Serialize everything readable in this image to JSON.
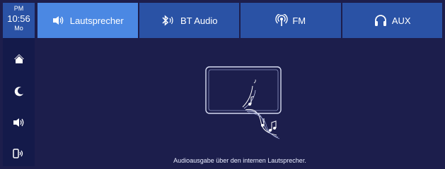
{
  "clock": {
    "ampm": "PM",
    "time": "10:56",
    "day": "Mo"
  },
  "sidebar": {
    "items": [
      {
        "icon": "home-icon"
      },
      {
        "icon": "moon-icon"
      },
      {
        "icon": "speaker-icon"
      },
      {
        "icon": "phone-audio-icon"
      }
    ]
  },
  "tabs": [
    {
      "label": "Lautsprecher",
      "icon": "speaker-icon",
      "active": true
    },
    {
      "label": "BT Audio",
      "icon": "bluetooth-icon",
      "active": false
    },
    {
      "label": "FM",
      "icon": "radio-icon",
      "active": false
    },
    {
      "label": "AUX",
      "icon": "headphones-icon",
      "active": false
    }
  ],
  "main": {
    "caption": "Audioausgabe über den internen Lautsprecher."
  },
  "colors": {
    "background": "#1c1e4c",
    "tab": "#2a52a5",
    "tab_active": "#4b88e3",
    "rail": "#141a4a"
  }
}
